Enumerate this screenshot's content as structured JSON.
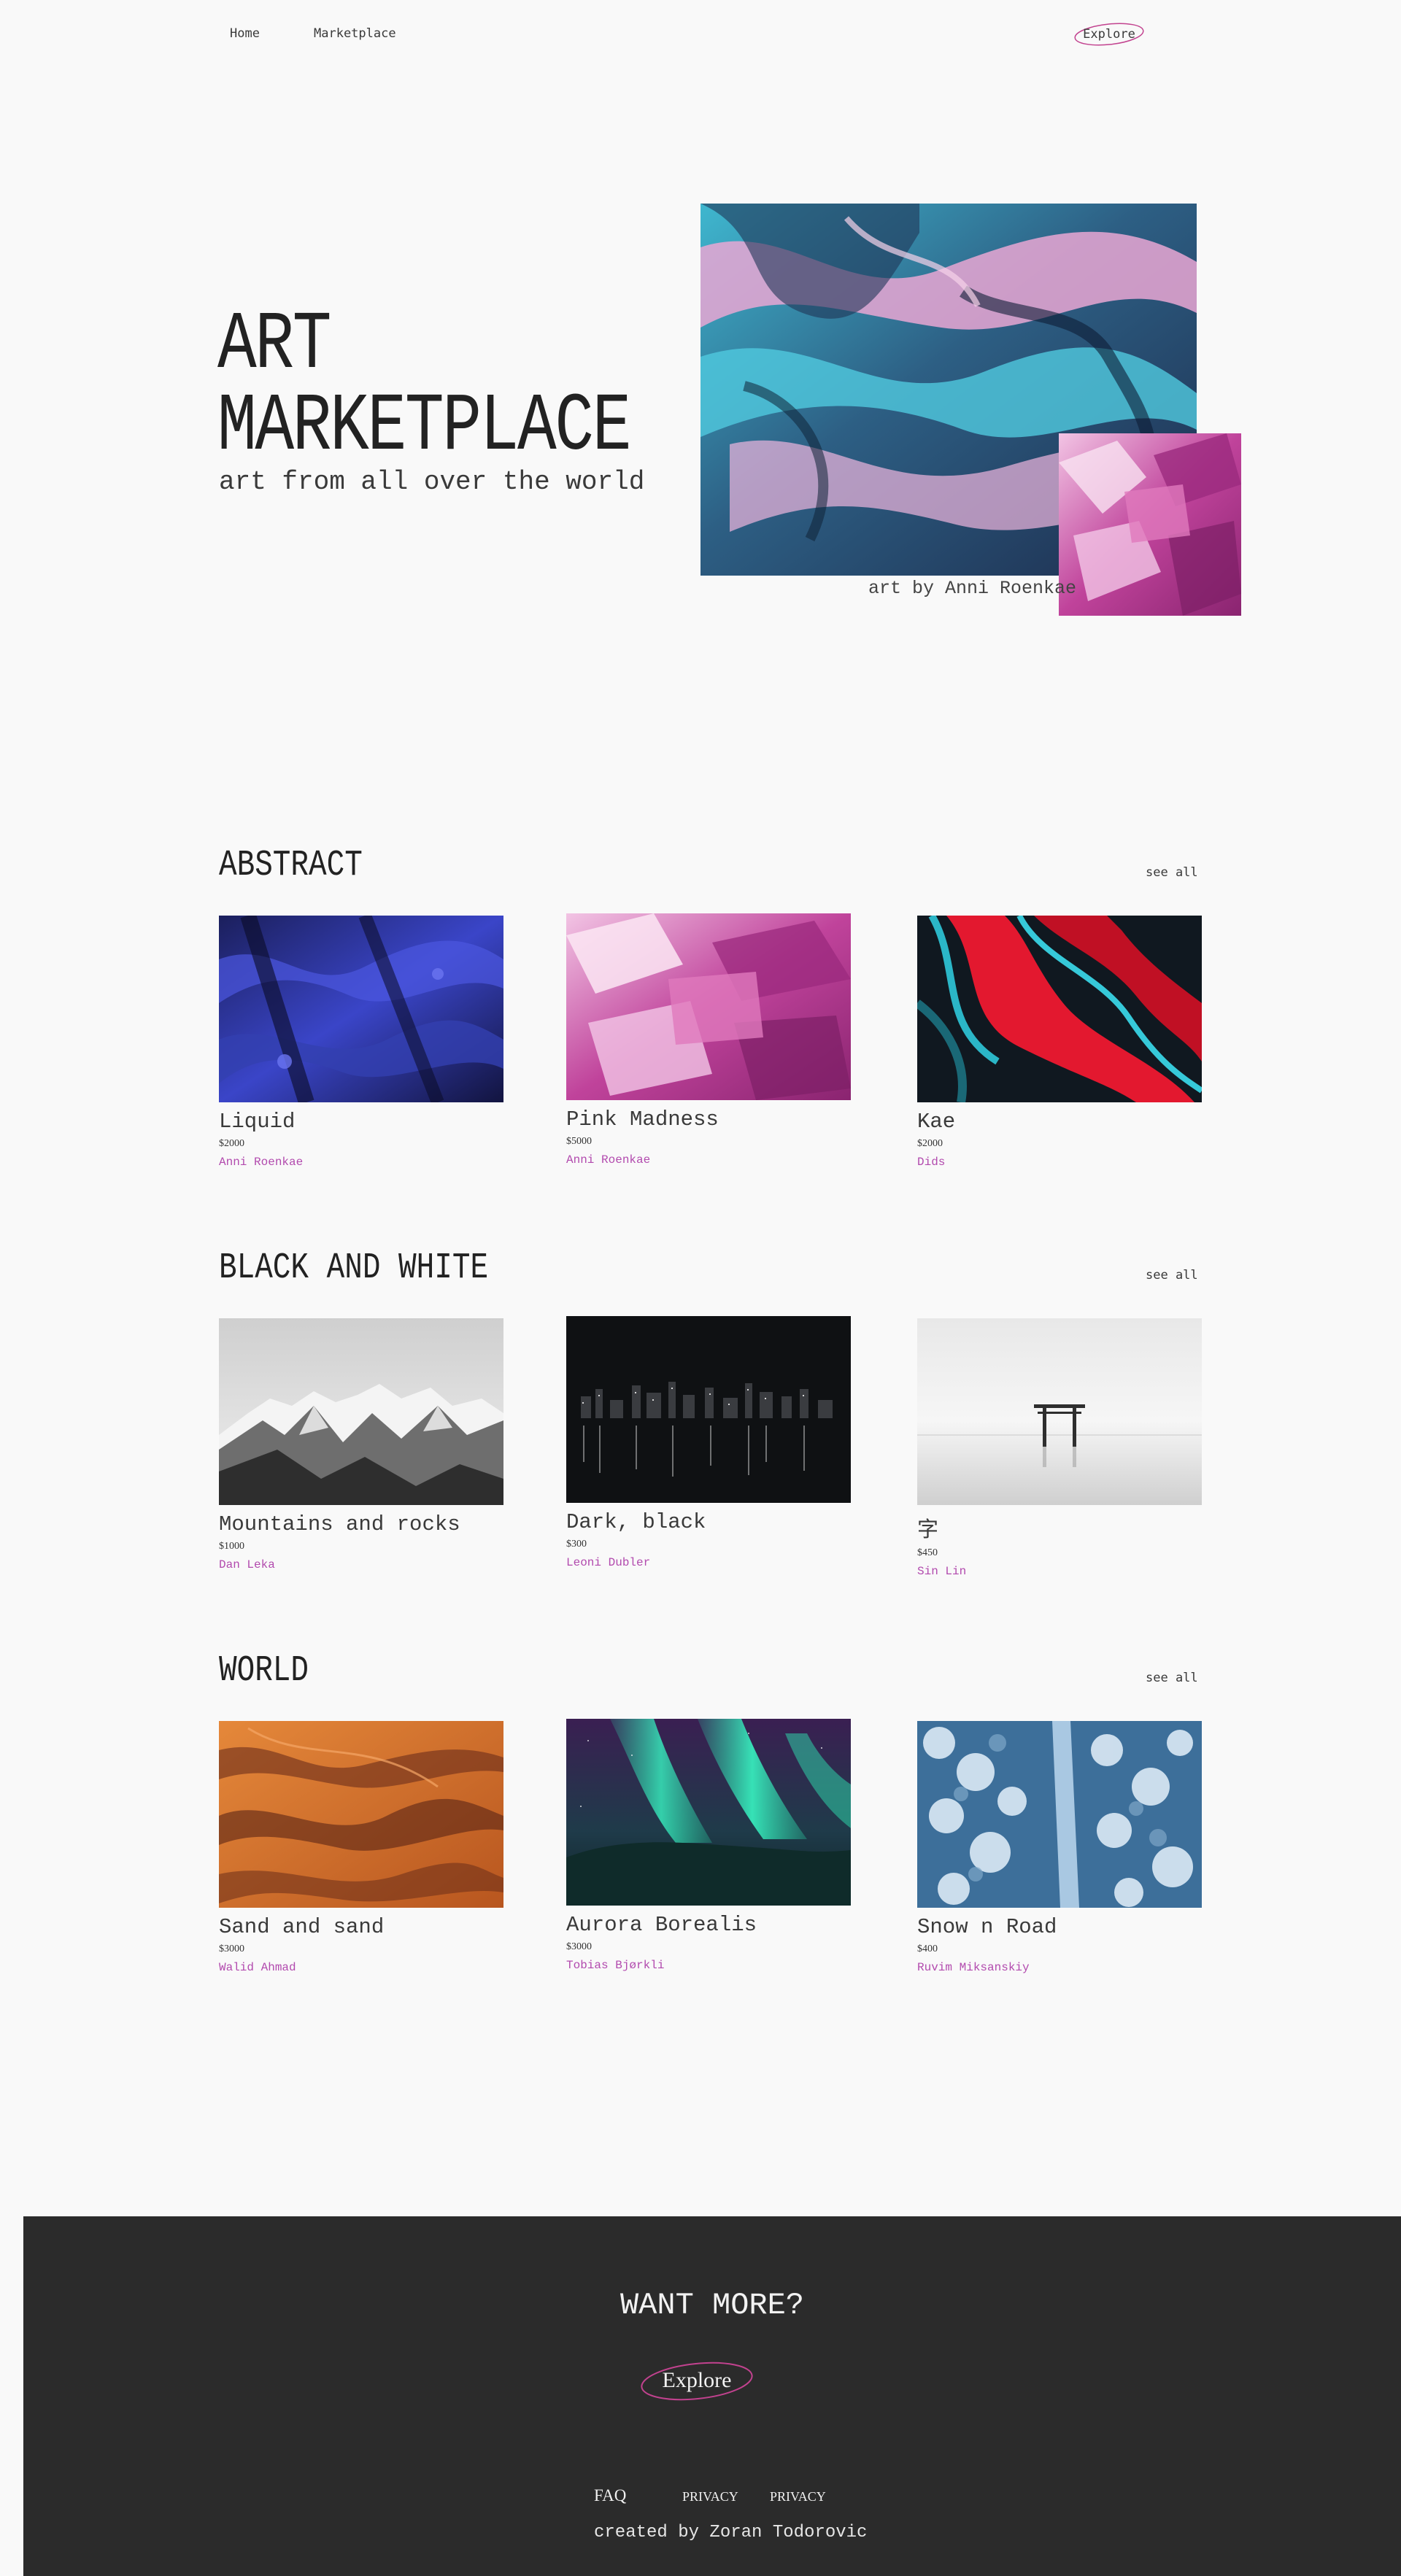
{
  "nav": {
    "home": "Home",
    "marketplace": "Marketplace",
    "explore": "Explore",
    "accent": "#c2428f"
  },
  "hero": {
    "title": "ART\nMARKETPLACE",
    "subtitle": "art from all over the world",
    "credit": "art by Anni Roenkae"
  },
  "sections": [
    {
      "title": "ABSTRACT",
      "see_all": "see all",
      "items": [
        {
          "title": "Liquid",
          "price": "$2000",
          "artist": "Anni Roenkae",
          "image": "blue-abstract-art"
        },
        {
          "title": "Pink Madness",
          "price": "$5000",
          "artist": "Anni Roenkae",
          "image": "pink-abstract-art"
        },
        {
          "title": "Kae",
          "price": "$2000",
          "artist": "Dids",
          "image": "red-teal-fluid-art"
        }
      ]
    },
    {
      "title": "BLACK AND WHITE",
      "see_all": "see all",
      "items": [
        {
          "title": "Mountains and rocks",
          "price": "$1000",
          "artist": "Dan Leka",
          "image": "snowy-mountains-photo"
        },
        {
          "title": "Dark, black",
          "price": "$300",
          "artist": "Leoni Dubler",
          "image": "night-city-skyline-photo"
        },
        {
          "title": "字",
          "price": "$450",
          "artist": "Sin Lin",
          "image": "torii-gate-in-water-photo"
        }
      ]
    },
    {
      "title": "WORLD",
      "see_all": "see all",
      "items": [
        {
          "title": "Sand and sand",
          "price": "$3000",
          "artist": "Walid Ahmad",
          "image": "desert-dunes-photo"
        },
        {
          "title": "Aurora Borealis",
          "price": "$3000",
          "artist": "Tobias Bjørkli",
          "image": "northern-lights-photo"
        },
        {
          "title": "Snow n Road",
          "price": "$400",
          "artist": "Ruvim Miksanskiy",
          "image": "snowy-forest-road-photo"
        }
      ]
    }
  ],
  "footer": {
    "title": "WANT MORE?",
    "explore": "Explore",
    "links": [
      "FAQ",
      "PRIVACY",
      "PRIVACY"
    ],
    "credit": "created by Zoran Todorovic"
  },
  "colors": {
    "background": "#f9f9f9",
    "footer": "#2b2b2b",
    "artist_accent": "#b24aae"
  }
}
